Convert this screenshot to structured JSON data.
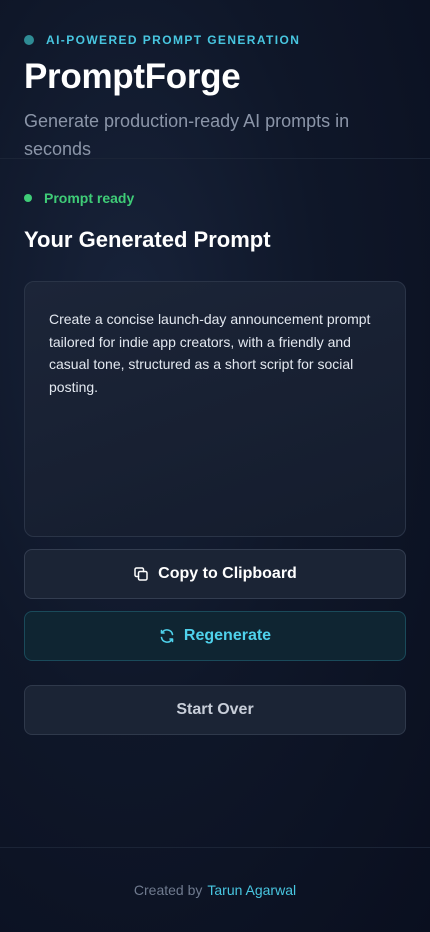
{
  "header": {
    "eyebrow": "AI-POWERED PROMPT GENERATION",
    "brand": "PromptForge",
    "tagline": "Generate production-ready AI prompts in seconds"
  },
  "status": {
    "text": "Prompt ready"
  },
  "result": {
    "title": "Your Generated Prompt",
    "prompt": "Create a concise launch-day announcement prompt tailored for indie app creators, with a friendly and casual tone, structured as a short script for social posting."
  },
  "actions": {
    "copy_label": "Copy to Clipboard",
    "copy_icon": "copy-icon",
    "regenerate_label": "Regenerate",
    "regenerate_icon": "refresh-icon",
    "start_over_label": "Start Over"
  },
  "footer": {
    "prefix": "Created by",
    "author": "Tarun Agarwal"
  },
  "colors": {
    "accent": "#48c6e0",
    "success": "#3fcc77",
    "background": "#0f1729"
  }
}
